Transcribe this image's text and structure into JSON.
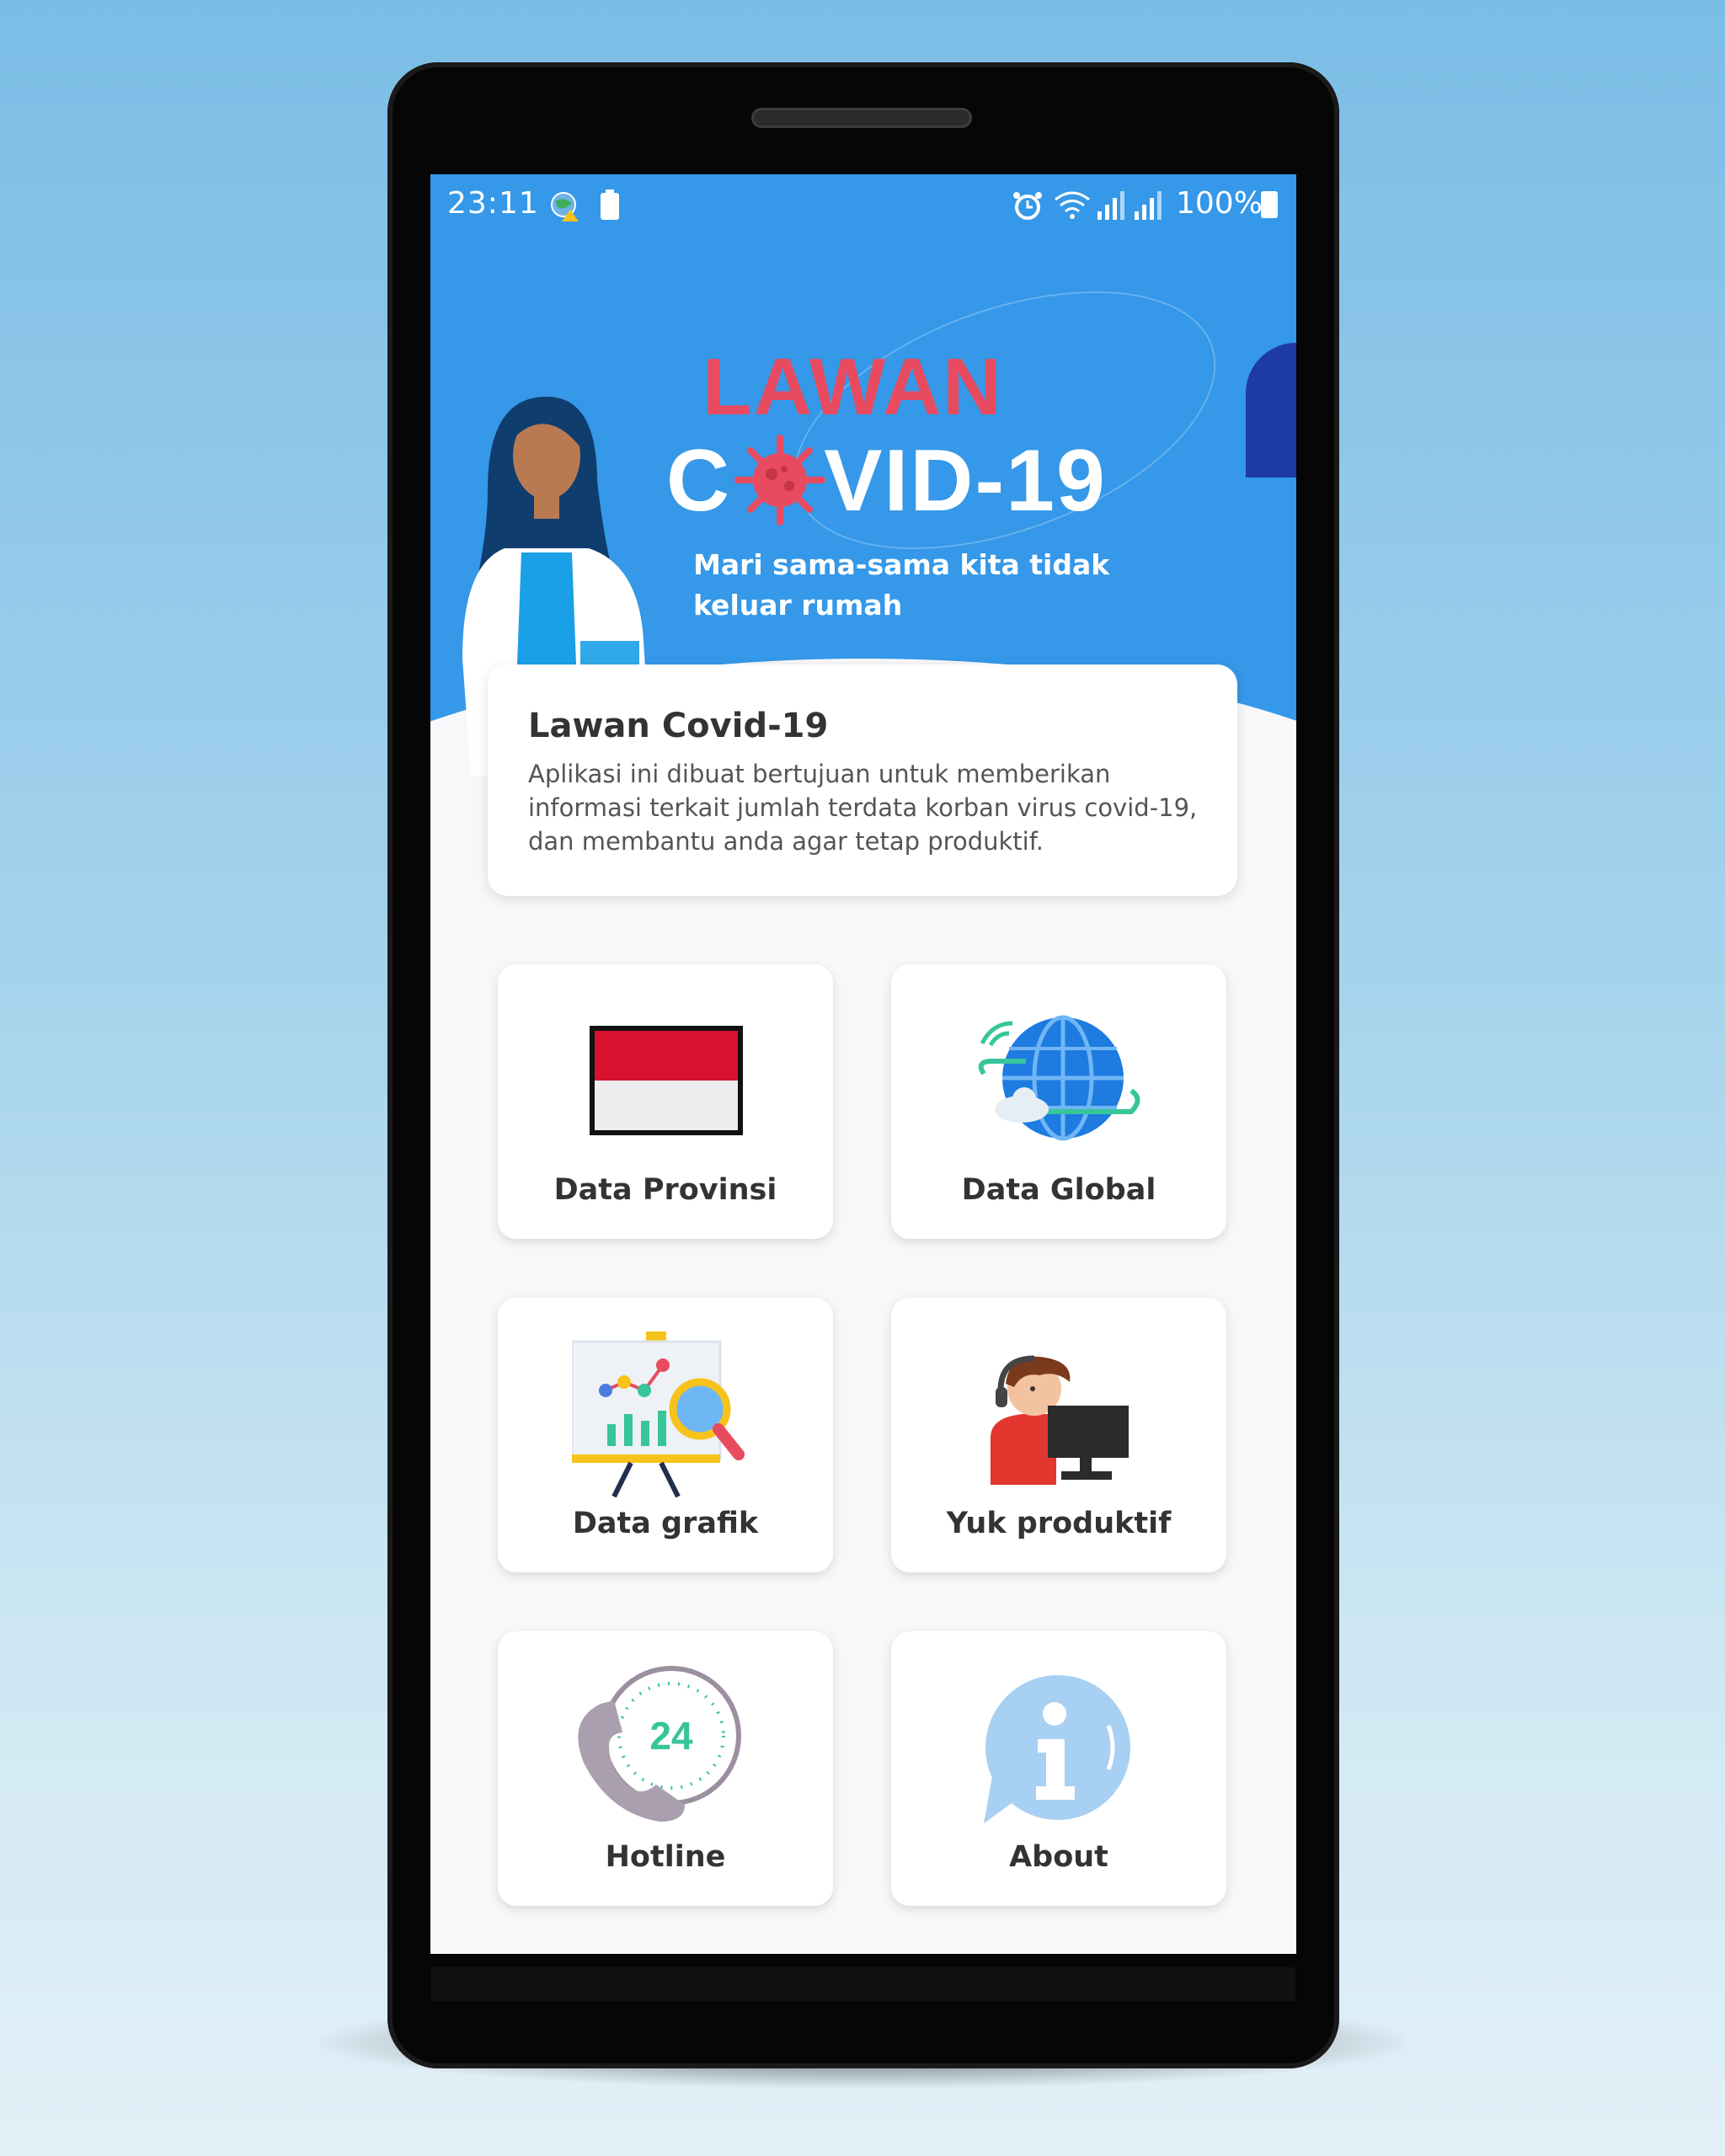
{
  "status_bar": {
    "time": "23:11",
    "battery": "100%",
    "icons": [
      "globe-warning-icon",
      "battery-100-icon",
      "alarm-icon",
      "wifi-icon",
      "signal-icon",
      "signal-icon",
      "battery-icon"
    ]
  },
  "header": {
    "title_line1": "LAWAN",
    "title_line2": "VID-19",
    "title_prefix": "C",
    "tagline": "Mari sama-sama kita tidak keluar rumah",
    "colors": {
      "background": "#3598e8",
      "accent": "#e84b5f"
    }
  },
  "info_card": {
    "title": "Lawan Covid-19",
    "text": "Aplikasi ini dibuat bertujuan untuk memberikan informasi terkait jumlah terdata korban virus covid-19, dan membantu anda agar tetap produktif."
  },
  "menu": [
    {
      "label": "Data Provinsi",
      "icon": "indonesia-flag-icon"
    },
    {
      "label": "Data Global",
      "icon": "globe-icon"
    },
    {
      "label": "Data grafik",
      "icon": "chart-board-icon"
    },
    {
      "label": "Yuk produktif",
      "icon": "person-computer-icon"
    },
    {
      "label": "Hotline",
      "icon": "phone-24-icon"
    },
    {
      "label": "About",
      "icon": "info-bubble-icon"
    }
  ],
  "hotline_badge": "24"
}
